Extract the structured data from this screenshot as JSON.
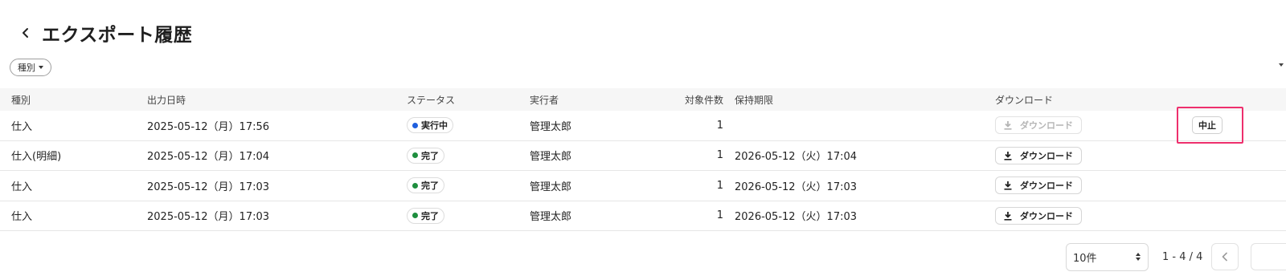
{
  "header": {
    "title": "エクスポート履歴"
  },
  "filter": {
    "label": "種別"
  },
  "table": {
    "columns": {
      "kind": "種別",
      "output_at": "出力日時",
      "status": "ステータス",
      "executor": "実行者",
      "count": "対象件数",
      "expires": "保持期限",
      "download": "ダウンロード"
    },
    "rows": [
      {
        "kind": "仕入",
        "output_at": "2025-05-12（月）17:56",
        "status": "実行中",
        "status_color": "#1f5fde",
        "executor": "管理太郎",
        "count": "1",
        "expires": "",
        "download": "ダウンロード",
        "download_enabled": false,
        "action": "中止"
      },
      {
        "kind": "仕入(明細)",
        "output_at": "2025-05-12（月）17:04",
        "status": "完了",
        "status_color": "#1e8e3e",
        "executor": "管理太郎",
        "count": "1",
        "expires": "2026-05-12（火）17:04",
        "download": "ダウンロード",
        "download_enabled": true
      },
      {
        "kind": "仕入",
        "output_at": "2025-05-12（月）17:03",
        "status": "完了",
        "status_color": "#1e8e3e",
        "executor": "管理太郎",
        "count": "1",
        "expires": "2026-05-12（火）17:03",
        "download": "ダウンロード",
        "download_enabled": true
      },
      {
        "kind": "仕入",
        "output_at": "2025-05-12（月）17:03",
        "status": "完了",
        "status_color": "#1e8e3e",
        "executor": "管理太郎",
        "count": "1",
        "expires": "2026-05-12（火）17:03",
        "download": "ダウンロード",
        "download_enabled": true
      }
    ]
  },
  "pagination": {
    "per_page": "10件",
    "range": "1 - 4 / 4"
  },
  "colors": {
    "highlight": "#ee2f6d",
    "running": "#1f5fde",
    "done": "#1e8e3e"
  }
}
